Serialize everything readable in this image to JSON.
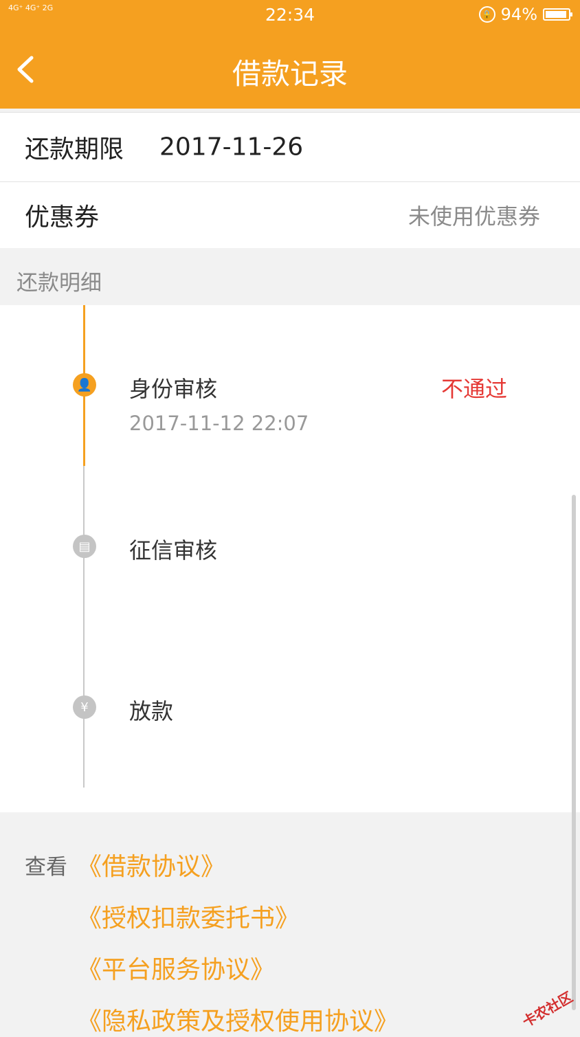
{
  "status_bar": {
    "network": "4G⁺ 4G⁺ 2G",
    "time": "22:34",
    "battery_percent": "94%",
    "battery_level": 0.94
  },
  "header": {
    "title": "借款记录",
    "back_icon": "chevron-left-icon"
  },
  "details": {
    "due_label": "还款期限",
    "due_value": "2017-11-26",
    "coupon_label": "优惠券",
    "coupon_value": "未使用优惠券"
  },
  "section": {
    "title": "还款明细"
  },
  "timeline": {
    "steps": [
      {
        "title": "身份审核",
        "time": "2017-11-12 22:07",
        "status": "不通过",
        "icon": "person-icon",
        "icon_glyph": "👤",
        "state": "active"
      },
      {
        "title": "征信审核",
        "time": "",
        "status": "",
        "icon": "document-icon",
        "icon_glyph": "▤",
        "state": "inactive"
      },
      {
        "title": "放款",
        "time": "",
        "status": "",
        "icon": "yen-icon",
        "icon_glyph": "¥",
        "state": "inactive"
      }
    ]
  },
  "footer": {
    "view_label": "查看",
    "links": [
      "《借款协议》",
      "《授权扣款委托书》",
      "《平台服务协议》",
      "《隐私政策及授权使用协议》"
    ]
  },
  "watermark": "卡农社区",
  "colors": {
    "accent": "#f5a020",
    "status_fail": "#e53935",
    "muted": "#8a8a8a"
  }
}
